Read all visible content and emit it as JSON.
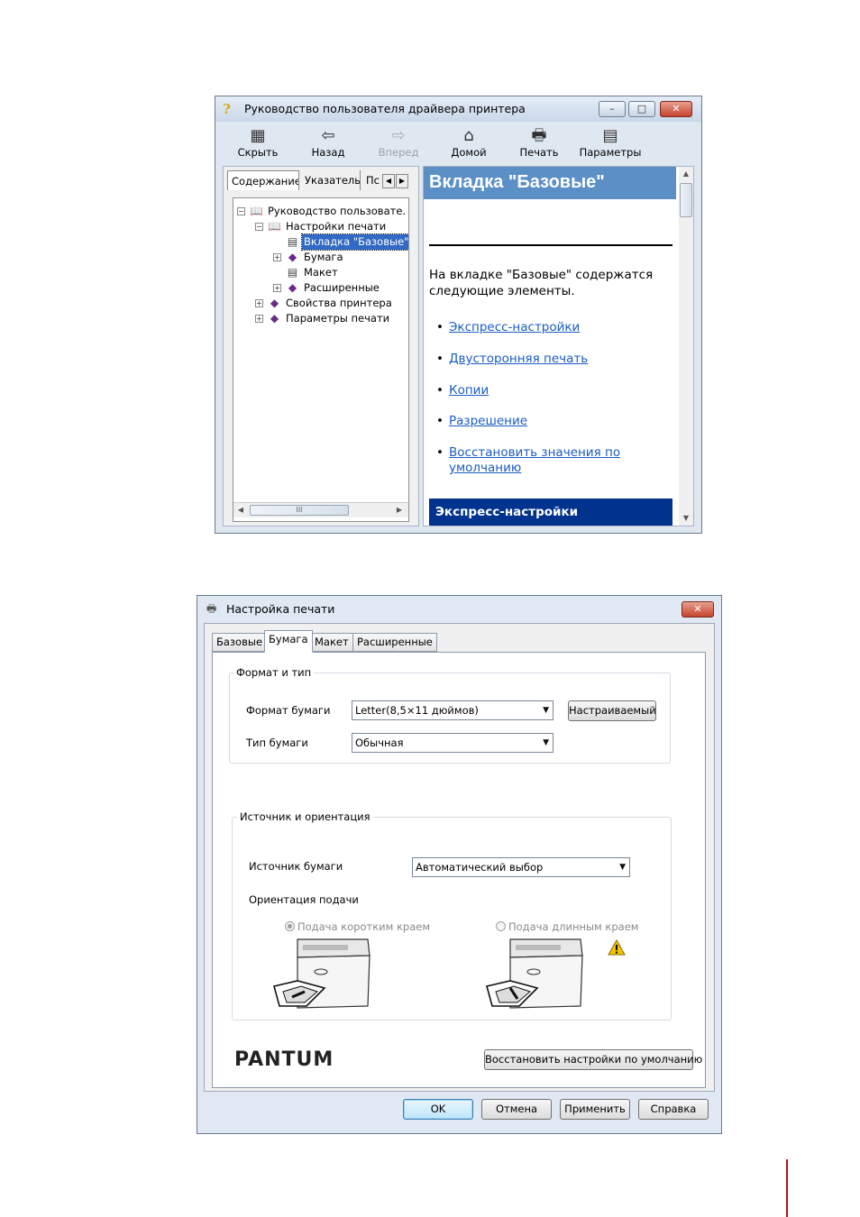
{
  "help_window": {
    "title": "Руководство пользователя драйвера принтера",
    "caption_buttons": {
      "minimize": "–",
      "maximize": "□",
      "close": "✕"
    },
    "toolbar": [
      {
        "label": "Скрыть",
        "icon": "hide-icon",
        "glyph": "▦",
        "enabled": true
      },
      {
        "label": "Назад",
        "icon": "back-icon",
        "glyph": "⇦",
        "enabled": true
      },
      {
        "label": "Вперед",
        "icon": "forward-icon",
        "glyph": "⇨",
        "enabled": false
      },
      {
        "label": "Домой",
        "icon": "home-icon",
        "glyph": "⌂",
        "enabled": true
      },
      {
        "label": "Печать",
        "icon": "print-icon",
        "glyph": "🖶",
        "enabled": true
      },
      {
        "label": "Параметры",
        "icon": "options-icon",
        "glyph": "▤",
        "enabled": true
      }
    ],
    "nav_tabs": [
      "Содержание",
      "Указатель",
      "Пс"
    ],
    "tree": [
      {
        "label": "Руководство пользовате.",
        "icon": "book-open",
        "expander": "−"
      },
      {
        "label": "Настройки печати",
        "icon": "book-open",
        "expander": "−"
      },
      {
        "label": "Вкладка \"Базовые\"",
        "icon": "page",
        "expander": "",
        "selected": true
      },
      {
        "label": "Бумага",
        "icon": "book-closed",
        "expander": "+"
      },
      {
        "label": "Макет",
        "icon": "page",
        "expander": ""
      },
      {
        "label": "Расширенные",
        "icon": "book-closed",
        "expander": "+"
      },
      {
        "label": "Свойства принтера",
        "icon": "book-closed",
        "expander": "+"
      },
      {
        "label": "Параметры печати",
        "icon": "book-closed",
        "expander": "+"
      }
    ],
    "tree_hscroll_grip": "III",
    "topic": {
      "title": "Вкладка \"Базовые\"",
      "intro": "На вкладке \"Базовые\" содержатся следующие элементы.",
      "links": [
        "Экспресс-настройки",
        "Двусторонняя печать",
        "Копии",
        "Разрешение",
        "Восстановить значения по умолчанию"
      ],
      "section": "Экспресс-настройки"
    }
  },
  "print_dialog": {
    "title": "Настройка печати",
    "close": "✕",
    "tabs": [
      "Базовые",
      "Бумага",
      "Макет",
      "Расширенные"
    ],
    "active_tab": "Бумага",
    "format_group": {
      "legend": "Формат и тип",
      "paper_size_label": "Формат бумаги",
      "paper_size_value": "Letter(8,5×11 дюймов)",
      "custom_button": "Настраиваемый",
      "paper_type_label": "Тип бумаги",
      "paper_type_value": "Обычная"
    },
    "source_group": {
      "legend": "Источник и ориентация",
      "source_label": "Источник бумаги",
      "source_value": "Автоматический выбор",
      "feed_label": "Ориентация подачи",
      "short_edge": "Подача коротким краем",
      "long_edge": "Подача длинным краем",
      "selected": "short_edge"
    },
    "brand": "PANTUM",
    "restore_button": "Восстановить настройки по умолчанию",
    "buttons": {
      "ok": "OK",
      "cancel": "Отмена",
      "apply": "Применить",
      "help": "Справка"
    }
  },
  "colors": {
    "topic_banner": "#5b8fc6",
    "section_banner": "#00338d",
    "link": "#1a5bc4",
    "page_marker": "#b3121e"
  }
}
